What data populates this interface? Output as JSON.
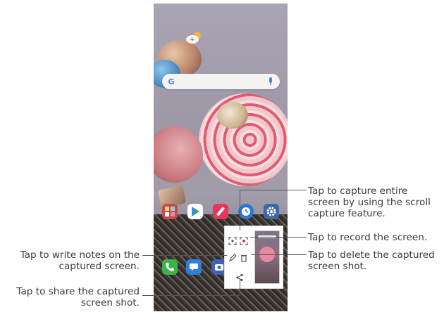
{
  "phone": {
    "weather_icon": "weather-sun-cloud-icon",
    "search_icon": "google-g-icon",
    "mic_icon": "mic-icon"
  },
  "apps_row1": [
    {
      "name": "folder-icon",
      "color": "#d04a4a"
    },
    {
      "name": "play-store-icon",
      "color": "#ffffff"
    },
    {
      "name": "qmemo-icon",
      "color": "#e8355a"
    },
    {
      "name": "clock-icon",
      "color": "#2a78d6"
    },
    {
      "name": "settings-icon",
      "color": "#3f67a8"
    }
  ],
  "apps_row2": [
    {
      "name": "phone-app-icon",
      "color": "#3bb54a"
    },
    {
      "name": "messages-app-icon",
      "color": "#2f7fd9"
    },
    {
      "name": "camera-app-icon",
      "color": "#3f62b8"
    }
  ],
  "capture_panel": {
    "icons": [
      "extended-capture-icon",
      "record-screen-icon",
      "edit-icon",
      "delete-icon",
      "share-icon"
    ]
  },
  "callouts": {
    "capture_entire": [
      "Tap to capture entire",
      "screen by using the scroll",
      "capture feature."
    ],
    "record": [
      "Tap to record the screen."
    ],
    "delete": [
      "Tap to delete the captured",
      "screen shot."
    ],
    "write_notes": [
      "Tap to write notes on the",
      "captured screen."
    ],
    "share": [
      "Tap to share the captured",
      "screen shot."
    ]
  }
}
